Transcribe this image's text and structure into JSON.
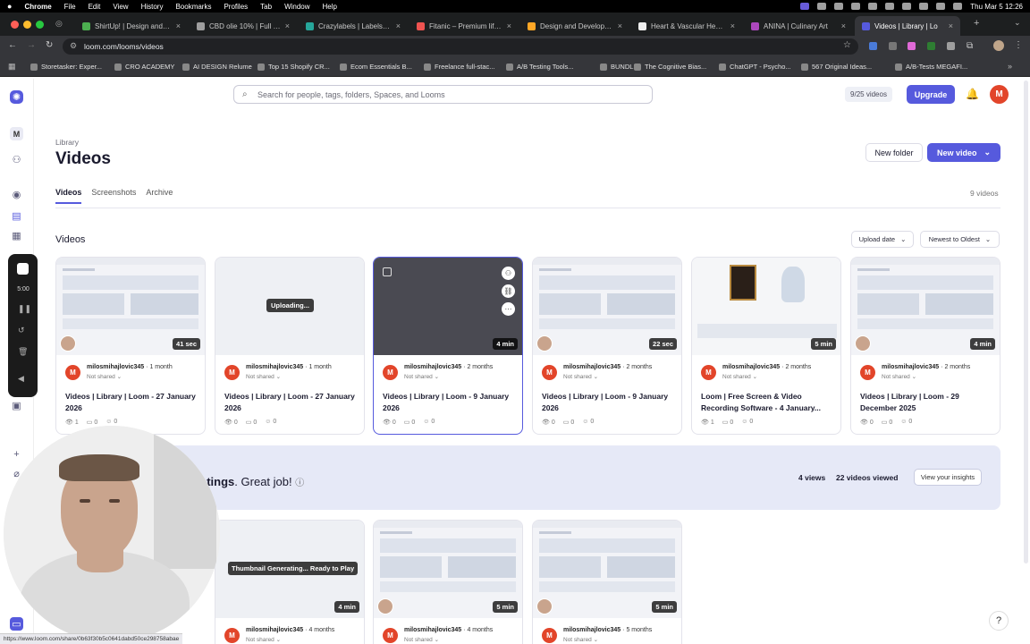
{
  "menubar": {
    "apple": "",
    "app": "Chrome",
    "items": [
      "File",
      "Edit",
      "View",
      "History",
      "Bookmarks",
      "Profiles",
      "Tab",
      "Window",
      "Help"
    ],
    "datetime": "Thu Mar 5  12:26"
  },
  "tabs": [
    {
      "label": "ShirtUp! | Design and Pr",
      "color": "#4caf50"
    },
    {
      "label": "CBD olie 10% | Full spec",
      "color": "#9e9e9e"
    },
    {
      "label": "Crazylabels | Labels be",
      "color": "#26a69a"
    },
    {
      "label": "Fitanic – Premium lifest",
      "color": "#ef5350"
    },
    {
      "label": "Design and Developme",
      "color": "#ffa726"
    },
    {
      "label": "Heart & Vascular Health",
      "color": "#eeeeee"
    },
    {
      "label": "ANINA | Culinary Art",
      "color": "#ab47bc"
    },
    {
      "label": "Videos | Library | Lo",
      "color": "#565add",
      "active": true
    }
  ],
  "browser": {
    "url": "loom.com/looms/videos"
  },
  "bookmarks": [
    "Storetasker: Exper...",
    "CRO ACADEMY",
    "AI DESIGN Relume",
    "Top 15 Shopify CR...",
    "Ecom Essentials B...",
    "Freelance full-stac...",
    "A/B Testing Tools...",
    "BUNDLE",
    "The Cognitive Bias...",
    "ChatGPT - Psycho...",
    "567 Original Ideas...",
    "A/B-Tests MEGAFI..."
  ],
  "header": {
    "search_placeholder": "Search for people, tags, folders, Spaces, and Looms",
    "video_count": "9/25 videos",
    "upgrade": "Upgrade",
    "avatar_initial": "M"
  },
  "library": {
    "breadcrumb": "Library",
    "title": "Videos",
    "new_folder": "New folder",
    "new_video": "New video",
    "tabs": [
      "Videos",
      "Screenshots",
      "Archive"
    ],
    "count": "9 videos",
    "section": "Videos",
    "sort_upload": "Upload date",
    "sort_order": "Newest to Oldest"
  },
  "videos": [
    {
      "duration": "41 sec",
      "user": "milosmihajlovic345",
      "age": "1 month",
      "share": "Not shared",
      "title": "Videos | Library | Loom - 27 January 2026",
      "views": "1",
      "comments": "0",
      "reactions": "0"
    },
    {
      "status": "Uploading...",
      "user": "milosmihajlovic345",
      "age": "1 month",
      "share": "Not shared",
      "title": "Videos | Library | Loom - 27 January 2026",
      "views": "0",
      "comments": "0",
      "reactions": "0"
    },
    {
      "duration": "4 min",
      "user": "milosmihajlovic345",
      "age": "2 months",
      "share": "Not shared",
      "title": "Videos | Library | Loom - 9 January 2026",
      "views": "0",
      "comments": "0",
      "reactions": "0"
    },
    {
      "duration": "22 sec",
      "user": "milosmihajlovic345",
      "age": "2 months",
      "share": "Not shared",
      "title": "Videos | Library | Loom - 9 January 2026",
      "views": "0",
      "comments": "0",
      "reactions": "0"
    },
    {
      "duration": "5 min",
      "user": "milosmihajlovic345",
      "age": "2 months",
      "share": "Not shared",
      "title": "Loom | Free Screen & Video Recording Software - 4 January...",
      "views": "1",
      "comments": "0",
      "reactions": "0"
    },
    {
      "duration": "4 min",
      "user": "milosmihajlovic345",
      "age": "2 months",
      "share": "Not shared",
      "title": "Videos | Library | Loom - 29 December 2025",
      "views": "0",
      "comments": "0",
      "reactions": "0"
    }
  ],
  "insights": {
    "message_bold": "etings",
    "message_rest": ". Great job!",
    "views": "4 views",
    "viewed": "22 videos viewed",
    "button": "View your insights"
  },
  "row2": [
    {
      "duration": "4 min",
      "status": "Thumbnail Generating... Ready to Play",
      "user": "milosmihajlovic345",
      "age": "4 months",
      "share": "Not shared"
    },
    {
      "duration": "5 min",
      "user": "milosmihajlovic345",
      "age": "4 months",
      "share": "Not shared"
    },
    {
      "duration": "5 min",
      "user": "milosmihajlovic345",
      "age": "5 months",
      "share": "Not shared"
    }
  ],
  "statusbar": "https://www.loom.com/share/0b63f30b5c0641dabd50ce298758abae",
  "recorder_time": "5:00",
  "help": "?",
  "colors": {
    "accent": "#565add",
    "avatar": "#e2452a",
    "insights_bg": "#e6e9f7"
  }
}
